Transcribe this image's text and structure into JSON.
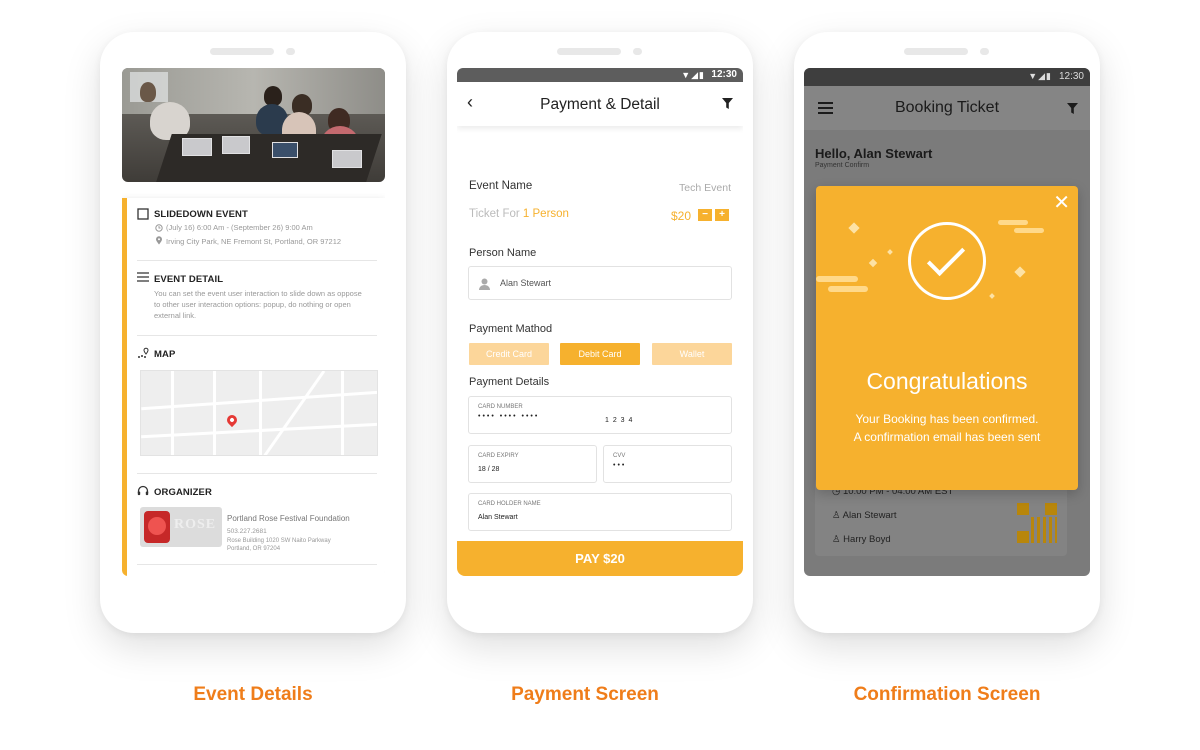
{
  "colors": {
    "accent": "#f6b12e",
    "caption": "#ef7d1a",
    "status_bar": "#5d5d5d"
  },
  "status": {
    "time": "12:30",
    "icons": "wifi signal battery"
  },
  "event_details": {
    "caption": "Event Details",
    "event": {
      "title": "SLIDEDOWN EVENT",
      "datetime": "(July 16) 6:00 Am - (September 26) 9:00 Am",
      "address": "Irving City Park, NE Fremont St, Portland, OR 97212"
    },
    "event_detail": {
      "title": "EVENT DETAIL",
      "description": "You can set the event user interaction to slide down as oppose to other user interaction options: popup, do nothing or open external link."
    },
    "map": {
      "title": "MAP"
    },
    "organizer": {
      "title": "ORGANIZER",
      "logo_text": "ROSE",
      "name": "Portland Rose Festival Foundation",
      "phone": "503.227.2681",
      "address_line1": "Rose Building 1020 SW Naito Parkway",
      "address_line2": "Portland, OR 97204"
    }
  },
  "payment": {
    "caption": "Payment Screen",
    "title": "Payment & Detail",
    "event_name_label": "Event Name",
    "event_name_value": "Tech Event",
    "ticket_for_label": "Ticket For",
    "ticket_for_value": "1 Person",
    "price": "$20",
    "minus": "−",
    "plus": "+",
    "person_name_label": "Person Name",
    "person_name_value": "Alan Stewart",
    "payment_method_label": "Payment Mathod",
    "methods": [
      {
        "label": "Credit Card",
        "selected": false
      },
      {
        "label": "Debit Card",
        "selected": true
      },
      {
        "label": "Wallet",
        "selected": false
      }
    ],
    "payment_details_label": "Payment Details",
    "card_number_label": "CARD NUMBER",
    "card_number_masked": "•••• •••• ••••",
    "card_number_last": "1 2 3 4",
    "card_expiry_label": "CARD EXPIRY",
    "card_expiry_value": "18 / 28",
    "cvv_label": "CVV",
    "cvv_value": "•••",
    "holder_label": "CARD HOLDER NAME",
    "holder_value": "Alan Stewart",
    "pay_button": "PAY $20"
  },
  "confirmation": {
    "caption": "Confirmation Screen",
    "title": "Booking Ticket",
    "greeting": "Hello, Alan Stewart",
    "greeting_sub": "Payment Confirm",
    "modal_title": "Congratulations",
    "modal_line1": "Your Booking has been confirmed.",
    "modal_line2": "A confirmation email has been sent",
    "time_row": "10:00 PM - 04:00 AM EST",
    "attendee1": "Alan Stewart",
    "attendee2": "Harry Boyd"
  }
}
